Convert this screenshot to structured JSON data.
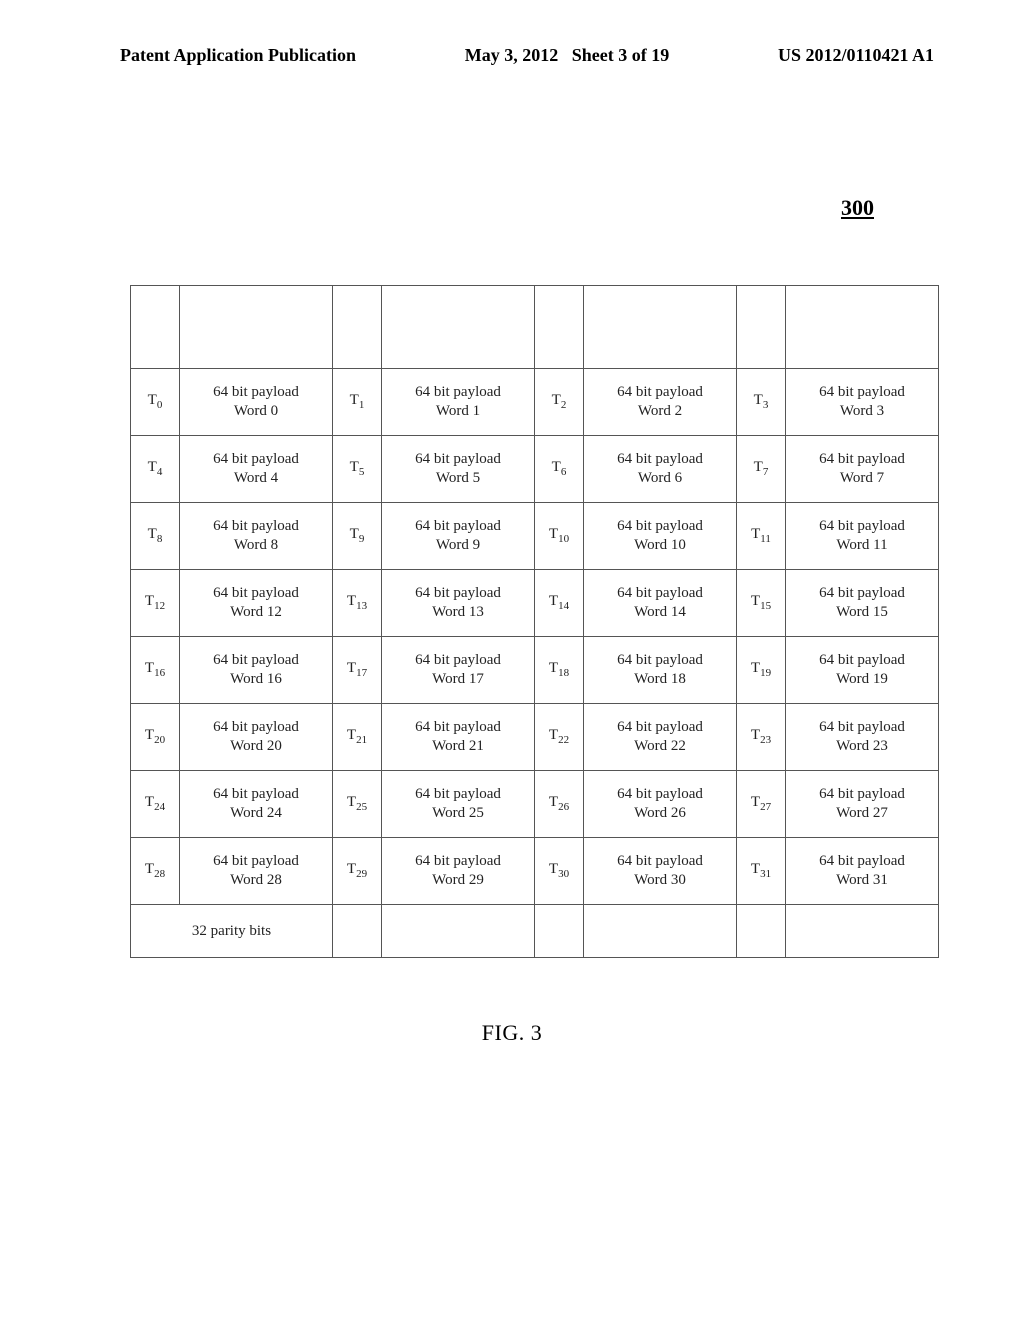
{
  "header": {
    "left": "Patent Application Publication",
    "center": "May 3, 2012",
    "sheet": "Sheet 3 of 19",
    "right": "US 2012/0110421 A1"
  },
  "figure_ref": "300",
  "figure_caption": "FIG. 3",
  "payload_label_prefix": "64 bit payload",
  "word_prefix": "Word",
  "t_prefix": "T",
  "parity_label": "32 parity bits",
  "grid": {
    "rows": 8,
    "cols": 4,
    "start_index": 0
  }
}
